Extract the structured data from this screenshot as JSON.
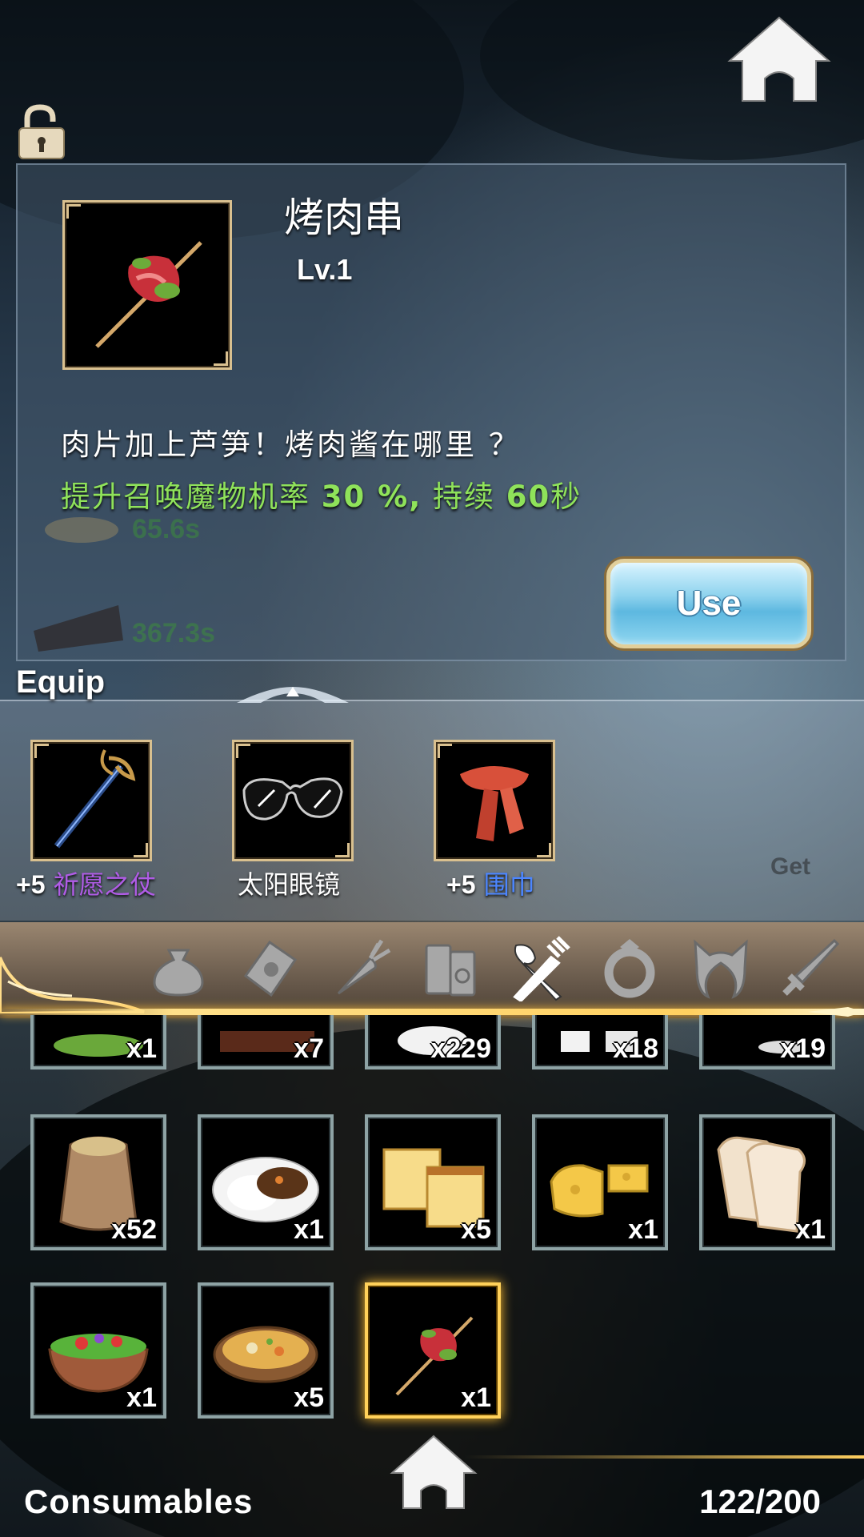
{
  "item_detail": {
    "name": "烤肉串",
    "level": "Lv.1",
    "description": "肉片加上芦笋！烤肉酱在哪里 ？",
    "effect": {
      "prefix": "提升召唤魔物机率 ",
      "rate": "30 %,",
      "middle": " 持续 ",
      "duration_value": "60",
      "duration_unit": "秒"
    },
    "icon": "kebab-icon",
    "use_label": "Use"
  },
  "background_timers": [
    "65.6s",
    "367.3s"
  ],
  "equip": {
    "title": "Equip",
    "items": [
      {
        "level": "+5",
        "name": "祈愿之仗",
        "name_color": "#b05ce6",
        "icon": "staff-icon"
      },
      {
        "level": "",
        "name": "太阳眼镜",
        "name_color": "#ffffff",
        "icon": "sunglasses-icon"
      },
      {
        "level": "+5",
        "name": "围巾",
        "name_color": "#4c86ff",
        "icon": "scarf-icon"
      }
    ],
    "get_label": "Get"
  },
  "categories": [
    {
      "icon": "bag-icon",
      "active": false
    },
    {
      "icon": "envelope-icon",
      "active": false
    },
    {
      "icon": "carrot-icon",
      "active": false
    },
    {
      "icon": "book-icon",
      "active": false
    },
    {
      "icon": "fork-spoon-icon",
      "active": true
    },
    {
      "icon": "ring-icon",
      "active": false
    },
    {
      "icon": "cat-ears-icon",
      "active": false
    },
    {
      "icon": "sword-icon",
      "active": false
    }
  ],
  "inventory": {
    "rows": [
      [
        {
          "icon": "salad-partial-icon",
          "qty": "x1"
        },
        {
          "icon": "cake-partial-icon",
          "qty": "x7"
        },
        {
          "icon": "rice-ball-partial-icon",
          "qty": "x229"
        },
        {
          "icon": "milk-partial-icon",
          "qty": "x18"
        },
        {
          "icon": "bowl-partial-icon",
          "qty": "x19"
        }
      ],
      [
        {
          "icon": "flour-sack-icon",
          "qty": "x52"
        },
        {
          "icon": "curry-rice-icon",
          "qty": "x1"
        },
        {
          "icon": "castella-icon",
          "qty": "x5"
        },
        {
          "icon": "cheese-icon",
          "qty": "x1"
        },
        {
          "icon": "toast-icon",
          "qty": "x1"
        }
      ],
      [
        {
          "icon": "salad-icon",
          "qty": "x1"
        },
        {
          "icon": "stew-icon",
          "qty": "x5"
        },
        {
          "icon": "kebab-icon",
          "qty": "x1",
          "selected": true
        }
      ]
    ]
  },
  "footer": {
    "title": "Consumables",
    "count": "122/200"
  },
  "colors": {
    "accent_gold": "#ffd15a",
    "effect_green": "#8fe25a",
    "slot_border": "#8ea3a5"
  }
}
